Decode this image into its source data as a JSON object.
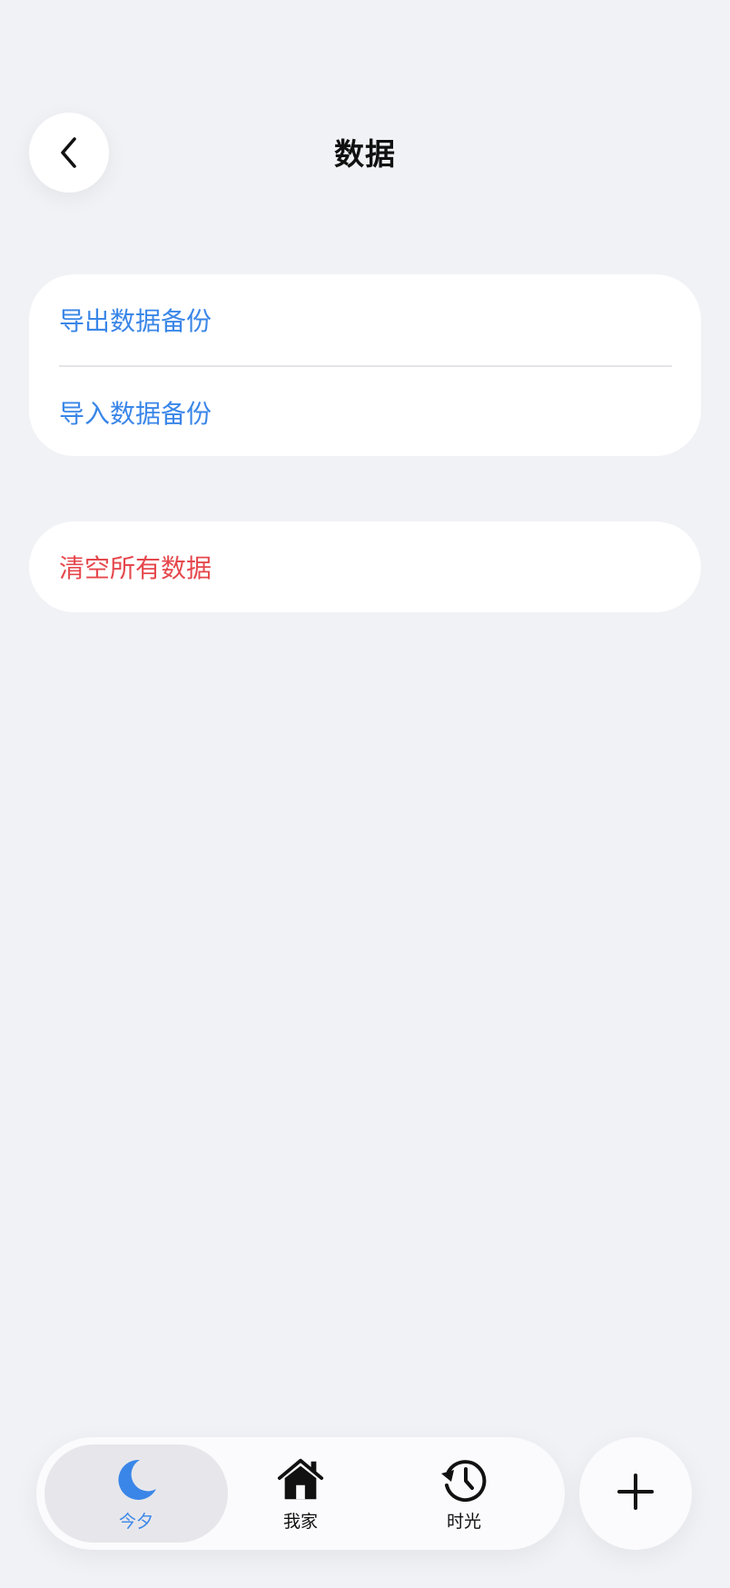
{
  "header": {
    "title": "数据",
    "back_icon": "chevron-left-icon"
  },
  "backup_section": {
    "items": [
      {
        "label": "导出数据备份",
        "color": "#3a86e8"
      },
      {
        "label": "导入数据备份",
        "color": "#3a86e8"
      }
    ]
  },
  "danger_section": {
    "items": [
      {
        "label": "清空所有数据",
        "color": "#e5484d"
      }
    ]
  },
  "tabbar": {
    "tabs": [
      {
        "label": "今夕",
        "icon": "moon-icon",
        "active": true
      },
      {
        "label": "我家",
        "icon": "house-icon",
        "active": false
      },
      {
        "label": "时光",
        "icon": "history-clock-icon",
        "active": false
      }
    ],
    "add_icon": "plus-icon"
  },
  "colors": {
    "accent": "#3a86e8",
    "danger": "#e5484d",
    "background": "#f1f2f6"
  }
}
